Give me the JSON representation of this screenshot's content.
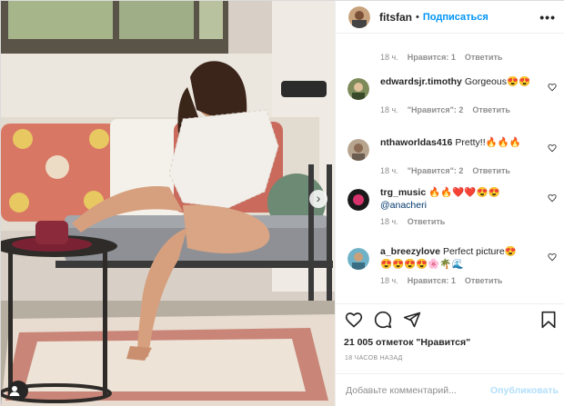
{
  "post": {
    "username": "fitsfan",
    "follow_label": "Подписаться",
    "dot": "•",
    "more_icon": "more-dots-icon",
    "more_label": "•••",
    "caption_meta": {
      "time": "18 ч.",
      "likes": "Нравится: 1",
      "reply": "Ответить"
    },
    "next_icon": "chevron-right-icon",
    "next_label": "›",
    "tag_icon": "user-tag-icon"
  },
  "comments": [
    {
      "user": "edwardsjr.timothy",
      "text": "Gorgeous😍😍",
      "mention": "",
      "time": "18 ч.",
      "likes": "\"Нравится\": 2",
      "reply": "Ответить"
    },
    {
      "user": "nthaworldas416",
      "text": "Pretty!!🔥🔥🔥",
      "mention": "",
      "time": "18 ч.",
      "likes": "\"Нравится\": 2",
      "reply": "Ответить"
    },
    {
      "user": "trg_music",
      "text": "🔥🔥❤️❤️😍😍",
      "mention": "@anacheri",
      "time": "18 ч.",
      "likes": "",
      "reply": "Ответить"
    },
    {
      "user": "a_breezylove",
      "text": "Perfect picture😍",
      "mention": "😍😍😍😍🌸🌴🌊",
      "time": "18 ч.",
      "likes": "Нравится: 1",
      "reply": "Ответить"
    }
  ],
  "actions": {
    "like_icon": "heart-icon",
    "comment_icon": "comment-icon",
    "share_icon": "share-icon",
    "save_icon": "bookmark-icon"
  },
  "likes_count": "21 005 отметок \"Нравится\"",
  "timestamp": "18 ЧАСОВ НАЗАД",
  "add_comment": {
    "placeholder": "Добавьте комментарий...",
    "publish_label": "Опубликовать"
  },
  "colors": {
    "accent": "#0095f6",
    "muted": "#8e8e8e",
    "publish_disabled": "#b2dffc"
  }
}
